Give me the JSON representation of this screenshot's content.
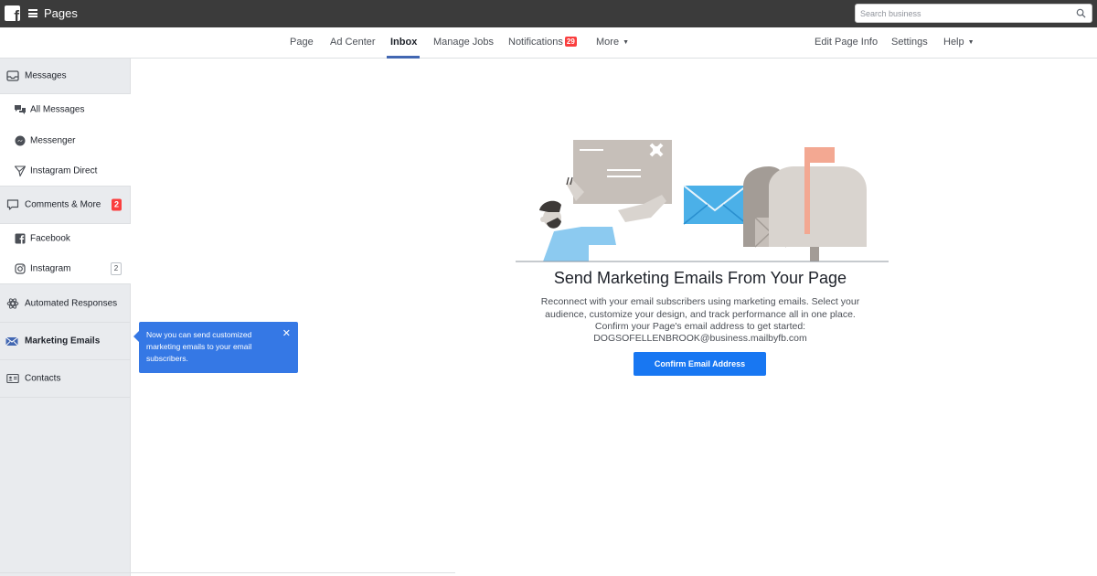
{
  "topbar": {
    "title": "Pages",
    "search_placeholder": "Search business"
  },
  "nav": {
    "items": [
      {
        "label": "Page"
      },
      {
        "label": "Ad Center"
      },
      {
        "label": "Inbox",
        "active": true
      },
      {
        "label": "Manage Jobs"
      },
      {
        "label": "Notifications",
        "badge": "29"
      },
      {
        "label": "More"
      }
    ],
    "right_items": [
      {
        "label": "Edit Page Info"
      },
      {
        "label": "Settings"
      },
      {
        "label": "Help"
      }
    ]
  },
  "sidebar": {
    "items": [
      {
        "label": "Messages",
        "icon": "inbox-tray-icon"
      },
      {
        "label": "All Messages",
        "icon": "chat-bubbles-icon"
      },
      {
        "label": "Messenger",
        "icon": "messenger-icon"
      },
      {
        "label": "Instagram Direct",
        "icon": "paper-plane-icon"
      },
      {
        "label": "Comments & More",
        "icon": "comment-icon",
        "count": "2"
      },
      {
        "label": "Facebook",
        "icon": "facebook-icon"
      },
      {
        "label": "Instagram",
        "icon": "instagram-icon",
        "count": "2"
      },
      {
        "label": "Automated Responses",
        "icon": "automation-icon"
      },
      {
        "label": "Marketing Emails",
        "icon": "envelope-icon",
        "active": true
      },
      {
        "label": "Contacts",
        "icon": "contact-card-icon"
      }
    ]
  },
  "tooltip": {
    "text": "Now you can send customized marketing emails to your email subscribers.",
    "close": "✕"
  },
  "main": {
    "title": "Send Marketing Emails From Your Page",
    "description": "Reconnect with your email subscribers using marketing emails. Select your audience, customize your design, and track performance all in one place. Confirm your Page's email address to get started:",
    "email": "DOGSOFELLENBROOK@business.mailbyfb.com",
    "button": "Confirm Email Address"
  },
  "colors": {
    "topbar": "#3b3b3b",
    "accent": "#4267b2",
    "button": "#1877f2",
    "tooltip": "#3578e5",
    "badge": "#fa3e3e"
  }
}
